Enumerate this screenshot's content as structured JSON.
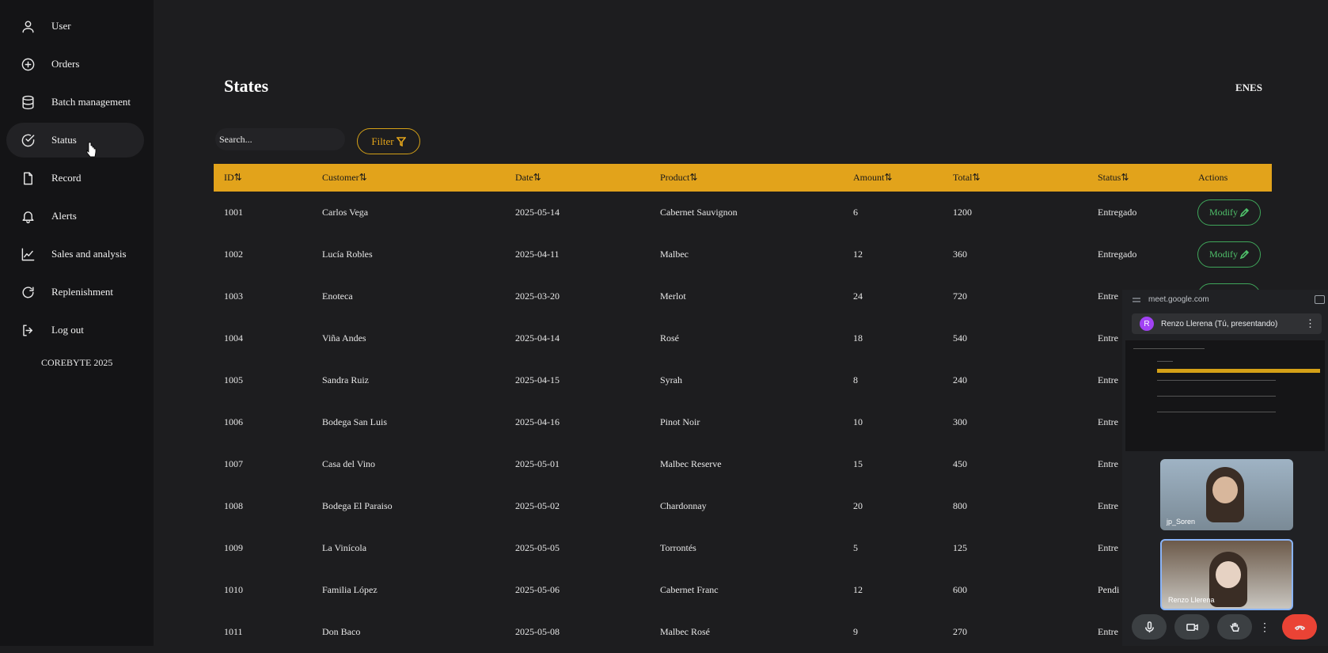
{
  "sidebar": {
    "items": [
      {
        "label": "User",
        "icon": "user-icon"
      },
      {
        "label": "Orders",
        "icon": "plus-circle-icon"
      },
      {
        "label": "Batch management",
        "icon": "database-icon"
      },
      {
        "label": "Status",
        "icon": "check-circle-icon"
      },
      {
        "label": "Record",
        "icon": "file-icon"
      },
      {
        "label": "Alerts",
        "icon": "bell-icon"
      },
      {
        "label": "Sales and analysis",
        "icon": "chart-line-icon"
      },
      {
        "label": "Replenishment",
        "icon": "refresh-icon"
      },
      {
        "label": "Log out",
        "icon": "logout-icon"
      }
    ],
    "brand": "COREBYTE 2025"
  },
  "header": {
    "title": "States",
    "language": "ENES"
  },
  "toolbar": {
    "search_placeholder": "Search...",
    "filter_label": "Filter"
  },
  "table": {
    "columns": [
      "ID⇅",
      "Customer⇅",
      "Date⇅",
      "Product⇅",
      "Amount⇅",
      "Total⇅",
      "Status⇅",
      "Actions"
    ],
    "action_label": "Modify",
    "rows": [
      [
        "1001",
        "Carlos Vega",
        "2025-05-14",
        "Cabernet Sauvignon",
        "6",
        "1200",
        "Entregado"
      ],
      [
        "1002",
        "Lucía Robles",
        "2025-04-11",
        "Malbec",
        "12",
        "360",
        "Entregado"
      ],
      [
        "1003",
        "Enoteca",
        "2025-03-20",
        "Merlot",
        "24",
        "720",
        "Entre"
      ],
      [
        "1004",
        "Viña Andes",
        "2025-04-14",
        "Rosé",
        "18",
        "540",
        "Entre"
      ],
      [
        "1005",
        "Sandra Ruiz",
        "2025-04-15",
        "Syrah",
        "8",
        "240",
        "Entre"
      ],
      [
        "1006",
        "Bodega San Luis",
        "2025-04-16",
        "Pinot Noir",
        "10",
        "300",
        "Entre"
      ],
      [
        "1007",
        "Casa del Vino",
        "2025-05-01",
        "Malbec Reserve",
        "15",
        "450",
        "Entre"
      ],
      [
        "1008",
        "Bodega El Paraiso",
        "2025-05-02",
        "Chardonnay",
        "20",
        "800",
        "Entre"
      ],
      [
        "1009",
        "La Vinícola",
        "2025-05-05",
        "Torrontés",
        "5",
        "125",
        "Entre"
      ],
      [
        "1010",
        "Familia López",
        "2025-05-06",
        "Cabernet Franc",
        "12",
        "600",
        "Pendi"
      ],
      [
        "1011",
        "Don Baco",
        "2025-05-08",
        "Malbec Rosé",
        "9",
        "270",
        "Entre"
      ]
    ]
  },
  "meet": {
    "url": "meet.google.com",
    "presenter_initial": "R",
    "presenter": "Renzo Llerena (Tú, presentando)",
    "tile1_name": "jp_Soren",
    "tile2_name": "Renzo Llerena"
  },
  "colors": {
    "accent": "#e2a31b",
    "action": "#4fc06a",
    "background": "#1d1d1f",
    "sidebar": "#141416"
  }
}
